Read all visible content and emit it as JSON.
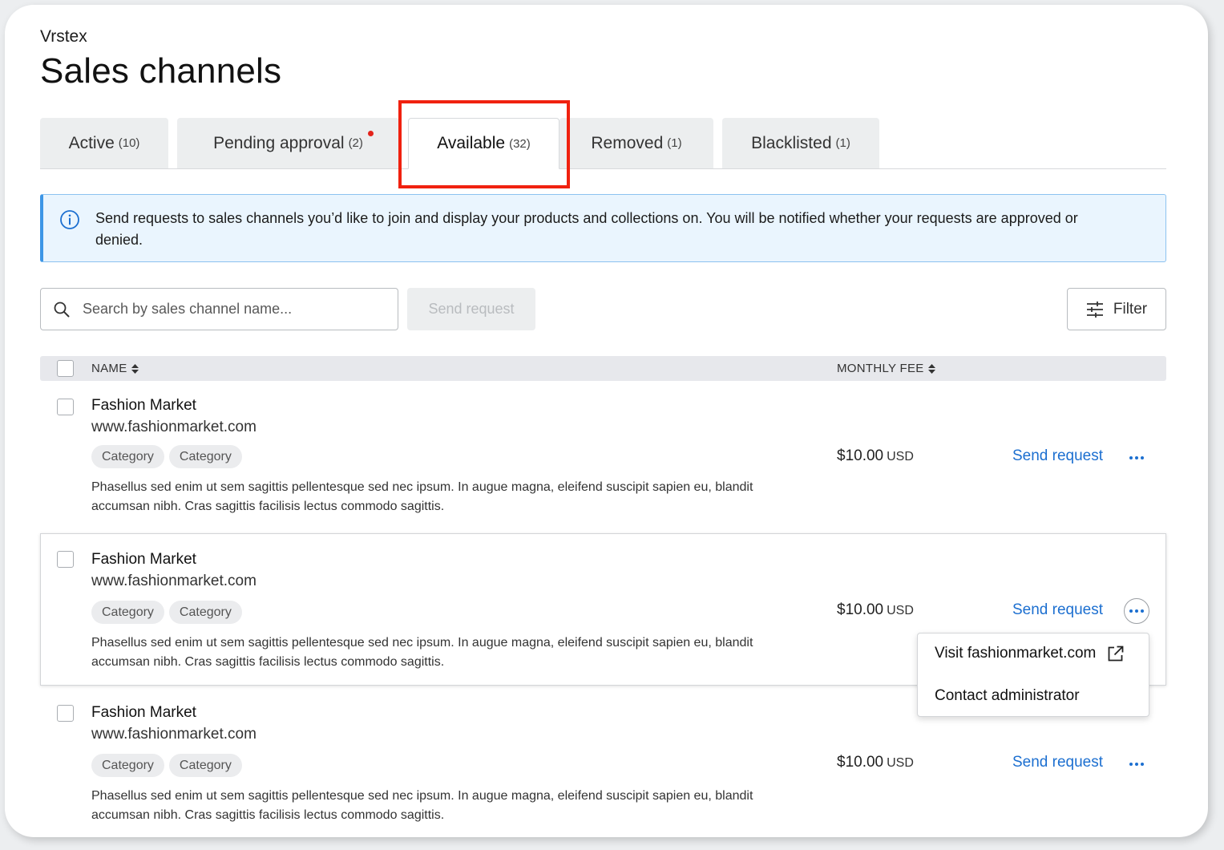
{
  "brand": "Vrstex",
  "page_title": "Sales channels",
  "tabs": [
    {
      "label": "Active",
      "count": "(10)"
    },
    {
      "label": "Pending approval",
      "count": "(2)"
    },
    {
      "label": "Available",
      "count": "(32)"
    },
    {
      "label": "Removed",
      "count": "(1)"
    },
    {
      "label": "Blacklisted",
      "count": "(1)"
    }
  ],
  "banner": {
    "icon": "info-icon",
    "message": "Send requests to sales channels you’d like to join and display your products and collections on. You will be notified whether your requests are approved or denied."
  },
  "toolbar": {
    "search_placeholder": "Search by sales channel name...",
    "send_request_label": "Send request",
    "filter_label": "Filter"
  },
  "table": {
    "columns": {
      "name": "NAME",
      "monthly_fee": "MONTHLY FEE"
    },
    "rows": [
      {
        "name": "Fashion Market",
        "url": "www.fashionmarket.com",
        "categories": [
          "Category",
          "Category"
        ],
        "description": "Phasellus sed enim ut sem sagittis pellentesque sed nec ipsum. In augue magna, eleifend suscipit sapien eu, blandit accumsan nibh. Cras sagittis facilisis lectus commodo sagittis.",
        "fee": "$10.00",
        "currency": "USD",
        "action": "Send request"
      },
      {
        "name": "Fashion Market",
        "url": "www.fashionmarket.com",
        "categories": [
          "Category",
          "Category"
        ],
        "description": "Phasellus sed enim ut sem sagittis pellentesque sed nec ipsum. In augue magna, eleifend suscipit sapien eu, blandit accumsan nibh. Cras sagittis facilisis lectus commodo sagittis.",
        "fee": "$10.00",
        "currency": "USD",
        "action": "Send request"
      },
      {
        "name": "Fashion Market",
        "url": "www.fashionmarket.com",
        "categories": [
          "Category",
          "Category"
        ],
        "description": "Phasellus sed enim ut sem sagittis pellentesque sed nec ipsum. In augue magna, eleifend suscipit sapien eu, blandit accumsan nibh. Cras sagittis facilisis lectus commodo sagittis.",
        "fee": "$10.00",
        "currency": "USD",
        "action": "Send request"
      }
    ]
  },
  "row_menu": {
    "visit_label": "Visit fashionmarket.com",
    "contact_label": "Contact administrator"
  },
  "colors": {
    "accent": "#1c6fd0",
    "highlight": "#f0210f",
    "notification_dot": "#e3231b",
    "info_border": "#3d96e6",
    "info_bg": "#eaf5fe"
  }
}
